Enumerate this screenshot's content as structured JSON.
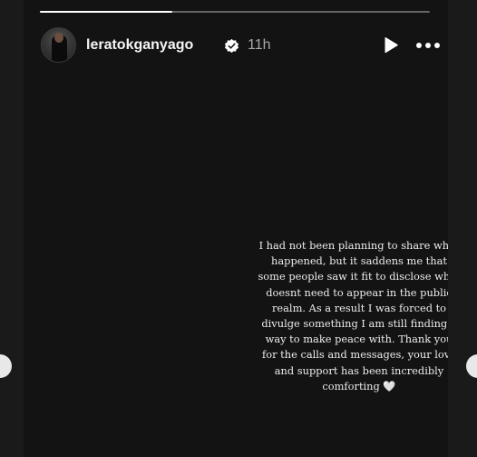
{
  "story": {
    "username": "leratokganyago",
    "timestamp": "11h",
    "progress": 0.34,
    "text": "I had not been planning to share what happened, but it saddens me that some people saw it fit to disclose what doesnt need to appear in the public realm. As a result I was forced to divulge something I am still finding a way to make peace with. Thank you for the calls and messages, your love and support has been incredibly comforting 🤍"
  },
  "icons": {
    "verified": "verified-badge-icon",
    "play": "play-icon",
    "more": "more-options-icon",
    "prev": "previous-story-arrow",
    "next": "next-story-arrow"
  },
  "colors": {
    "background": "#1a1a1a",
    "card": "#131313",
    "text": "#ececec",
    "muted": "#a8a8a8",
    "verified": "#ffffff"
  }
}
